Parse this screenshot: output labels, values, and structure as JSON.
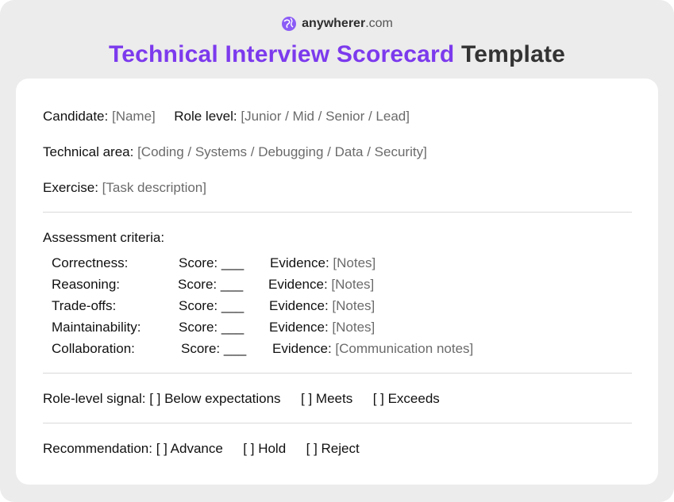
{
  "brand": {
    "name_bold": "anywherer",
    "name_rest": ".com",
    "logo_icon": "globe-pin-icon",
    "logo_color": "#8b5cf6"
  },
  "title": {
    "highlight": "Technical Interview Scorecard",
    "rest": "Template",
    "highlight_color": "#7c3aed"
  },
  "fields": {
    "candidate_label": "Candidate",
    "candidate_value": "[Name]",
    "role_level_label": "Role level",
    "role_level_value": "[Junior / Mid / Senior / Lead]",
    "technical_area_label": "Technical area",
    "technical_area_value": "[Coding / Systems / Debugging / Data / Security]",
    "exercise_label": "Exercise",
    "exercise_value": "[Task description]"
  },
  "assessment": {
    "heading": "Assessment criteria:",
    "score_label": "Score",
    "score_blank": "___",
    "evidence_label": "Evidence",
    "criteria": [
      {
        "name": "Correctness:",
        "evidence": "[Notes]"
      },
      {
        "name": "Reasoning:",
        "evidence": "[Notes]"
      },
      {
        "name": "Trade-offs:",
        "evidence": "[Notes]"
      },
      {
        "name": "Maintainability:",
        "evidence": "[Notes]"
      },
      {
        "name": "Collaboration:",
        "evidence": "[Communication notes]"
      }
    ]
  },
  "role_signal": {
    "label": "Role-level signal",
    "opt1": "[ ] Below expectations",
    "opt2": "[ ] Meets",
    "opt3": "[ ] Exceeds"
  },
  "recommendation": {
    "label": "Recommendation",
    "opt1": "[ ] Advance",
    "opt2": "[ ] Hold",
    "opt3": "[ ] Reject"
  }
}
